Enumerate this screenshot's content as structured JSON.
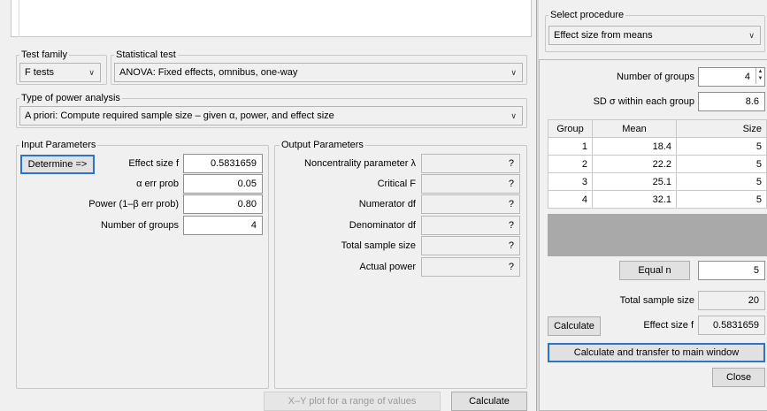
{
  "main": {
    "test_family": {
      "label": "Test family",
      "value": "F tests"
    },
    "statistical_test": {
      "label": "Statistical test",
      "value": "ANOVA: Fixed effects, omnibus, one-way"
    },
    "power_analysis": {
      "label": "Type of power analysis",
      "value": "A priori: Compute required sample size – given α, power, and effect size"
    },
    "input": {
      "title": "Input Parameters",
      "determine_label": "Determine =>",
      "rows": [
        {
          "label": "Effect size f",
          "value": "0.5831659"
        },
        {
          "label": "α err prob",
          "value": "0.05"
        },
        {
          "label": "Power (1–β err prob)",
          "value": "0.80"
        },
        {
          "label": "Number of groups",
          "value": "4"
        }
      ]
    },
    "output": {
      "title": "Output Parameters",
      "rows": [
        {
          "label": "Noncentrality parameter λ",
          "value": "?"
        },
        {
          "label": "Critical F",
          "value": "?"
        },
        {
          "label": "Numerator df",
          "value": "?"
        },
        {
          "label": "Denominator df",
          "value": "?"
        },
        {
          "label": "Total sample size",
          "value": "?"
        },
        {
          "label": "Actual power",
          "value": "?"
        }
      ]
    },
    "xy_plot_label": "X–Y plot for a range of values",
    "calculate_label": "Calculate"
  },
  "side": {
    "procedure": {
      "label": "Select procedure",
      "value": "Effect size from means"
    },
    "num_groups": {
      "label": "Number of groups",
      "value": "4"
    },
    "sd_within": {
      "label": "SD σ within each group",
      "value": "8.6"
    },
    "table": {
      "headers": [
        "Group",
        "Mean",
        "Size"
      ],
      "rows": [
        {
          "group": "1",
          "mean": "18.4",
          "size": "5"
        },
        {
          "group": "2",
          "mean": "22.2",
          "size": "5"
        },
        {
          "group": "3",
          "mean": "25.1",
          "size": "5"
        },
        {
          "group": "4",
          "mean": "32.1",
          "size": "5"
        }
      ]
    },
    "equal_n": {
      "label": "Equal n",
      "value": "5"
    },
    "total_sample": {
      "label": "Total sample size",
      "value": "20"
    },
    "effect_size": {
      "calc_label": "Calculate",
      "label": "Effect size f",
      "value": "0.5831659"
    },
    "transfer_label": "Calculate and transfer to main window",
    "close_label": "Close"
  }
}
